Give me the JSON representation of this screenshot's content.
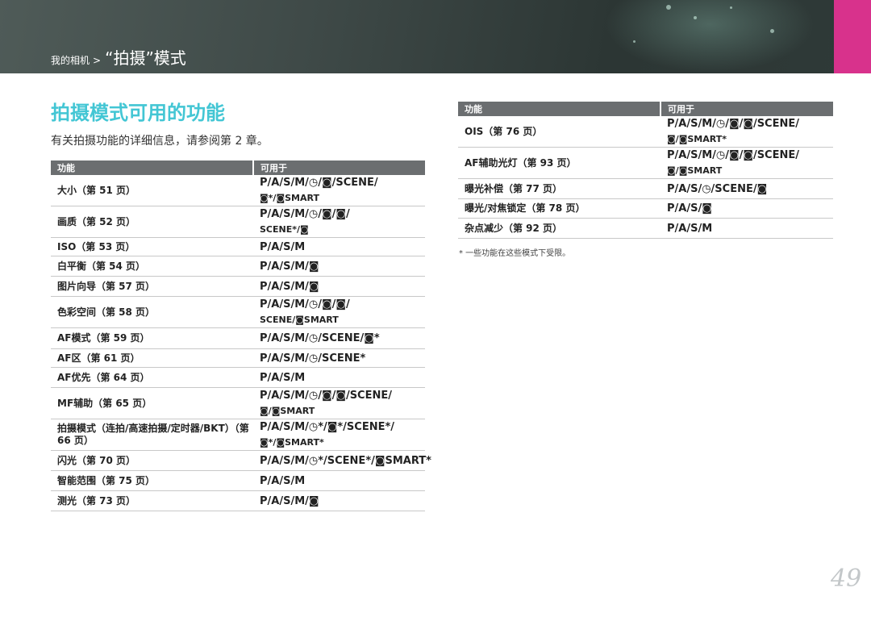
{
  "header": {
    "breadcrumb_small": "我的相机",
    "breadcrumb_sep": ">",
    "breadcrumb_big": "“拍摄”模式",
    "accent_color": "#d8328c"
  },
  "page": {
    "title": "拍摄模式可用的功能",
    "intro": "有关拍摄功能的详细信息，请参阅第 2 章。",
    "footnote": "* 一些功能在这些模式下受限。",
    "page_number": "49",
    "title_color": "#43c6d4"
  },
  "left_table": {
    "header": [
      "功能",
      "可用于"
    ],
    "rows": [
      {
        "feature": "大小（第 51 页）",
        "modes": [
          "P/A/S/M/◷/◙/SCENE/",
          "◙*/◙SMART"
        ]
      },
      {
        "feature": "画质（第 52 页）",
        "modes": [
          "P/A/S/M/◷/◙/◙/",
          "SCENE*/◙"
        ]
      },
      {
        "feature": "ISO（第 53 页）",
        "modes": [
          "P/A/S/M"
        ]
      },
      {
        "feature": "白平衡（第 54 页）",
        "modes": [
          "P/A/S/M/◙"
        ]
      },
      {
        "feature": "图片向导（第 57 页）",
        "modes": [
          "P/A/S/M/◙"
        ]
      },
      {
        "feature": "色彩空间（第 58 页）",
        "modes": [
          "P/A/S/M/◷/◙/◙/",
          "SCENE/◙SMART"
        ]
      },
      {
        "feature": "AF模式（第 59 页）",
        "modes": [
          "P/A/S/M/◷/SCENE/◙*"
        ]
      },
      {
        "feature": "AF区（第 61 页）",
        "modes": [
          "P/A/S/M/◷/SCENE*"
        ]
      },
      {
        "feature": "AF优先（第 64 页）",
        "modes": [
          "P/A/S/M"
        ]
      },
      {
        "feature": "MF辅助（第 65 页）",
        "modes": [
          "P/A/S/M/◷/◙/◙/SCENE/",
          "◙/◙SMART"
        ]
      },
      {
        "feature": "拍摄模式（连拍/高速拍摄/定时器/BKT）（第 66 页）",
        "modes": [
          "P/A/S/M/◷*/◙*/SCENE*/",
          "◙*/◙SMART*"
        ]
      },
      {
        "feature": "闪光（第 70 页）",
        "modes": [
          "P/A/S/M/◷*/SCENE*/◙SMART*"
        ]
      },
      {
        "feature": "智能范围（第 75 页）",
        "modes": [
          "P/A/S/M"
        ]
      },
      {
        "feature": "测光（第 73 页）",
        "modes": [
          "P/A/S/M/◙"
        ]
      }
    ]
  },
  "right_table": {
    "header": [
      "功能",
      "可用于"
    ],
    "rows": [
      {
        "feature": "OIS（第 76 页）",
        "modes": [
          "P/A/S/M/◷/◙/◙/SCENE/",
          "◙/◙SMART*"
        ]
      },
      {
        "feature": "AF辅助光灯（第 93 页）",
        "modes": [
          "P/A/S/M/◷/◙/◙/SCENE/",
          "◙/◙SMART"
        ]
      },
      {
        "feature": "曝光补偿（第 77 页）",
        "modes": [
          "P/A/S/◷/SCENE/◙"
        ]
      },
      {
        "feature": "曝光/对焦锁定（第 78 页）",
        "modes": [
          "P/A/S/◙"
        ]
      },
      {
        "feature": "杂点减少（第 92 页）",
        "modes": [
          "P/A/S/M"
        ]
      }
    ]
  }
}
